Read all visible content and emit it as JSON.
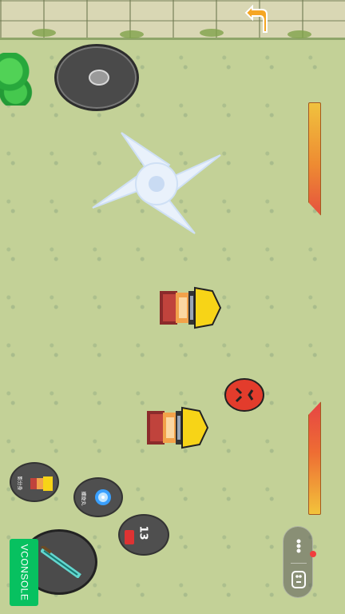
{
  "skills": {
    "clone_label": "影分身",
    "rasengan_label": "螺旋丸",
    "cooldown_value": "13"
  },
  "vconsole": {
    "label": "VCONSOLE"
  },
  "health_bars": {
    "top": {
      "fill": 1.0
    },
    "bottom": {
      "fill": 1.0
    }
  },
  "colors": {
    "grass": "#c3d197",
    "vconsole": "#07c160",
    "hp_warm": "#f0c23e",
    "hp_hot": "#e5523e"
  },
  "icons": {
    "back": "back-arrow-icon",
    "rage": "angry-face-icon",
    "attack": "sword-icon",
    "menu": "more-dots-icon",
    "exit": "game-controller-icon"
  }
}
